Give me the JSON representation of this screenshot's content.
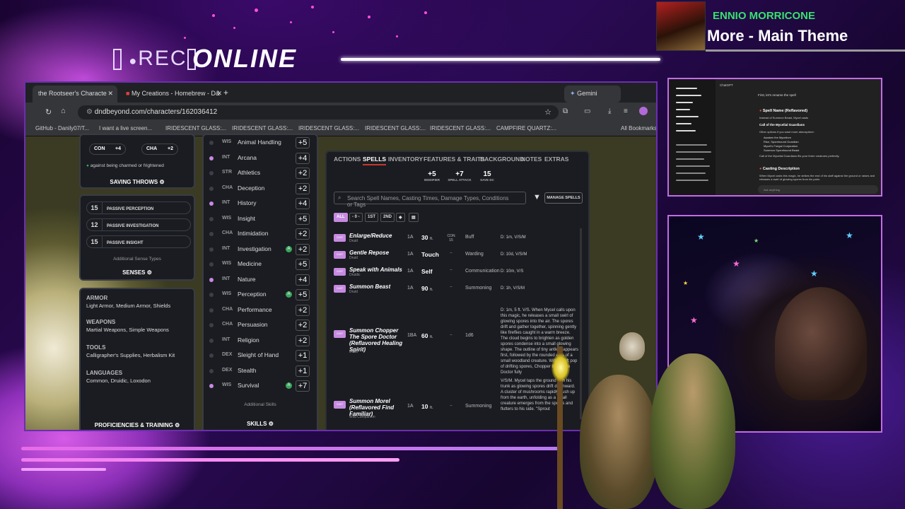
{
  "overlay": {
    "rec_label": "REC",
    "online_label": "ONLINE"
  },
  "now_playing": {
    "artist": "ENNIO MORRICONE",
    "title": "More - Main Theme",
    "artist_color": "#38e070"
  },
  "browser": {
    "tabs": [
      {
        "label": "the Rootseer's Characte",
        "active": true
      },
      {
        "label": "My Creations - Homebrew - D&",
        "active": false
      },
      {
        "label": "Gemini",
        "active": false
      }
    ],
    "url": "dndbeyond.com/characters/162036412",
    "bookmarks": [
      "GitHub - Danily07/T...",
      "I want a live screen...",
      "IRIDESCENT GLASS:...",
      "IRIDESCENT GLASS:...",
      "IRIDESCENT GLASS:...",
      "IRIDESCENT GLASS:...",
      "IRIDESCENT GLASS:...",
      "CAMPFIRE QUARTZ:...",
      "All Bookmarks"
    ]
  },
  "saving_throws": {
    "rows": [
      {
        "ability": "CON",
        "bonus": "+4"
      },
      {
        "ability": "CHA",
        "bonus": "+2"
      }
    ],
    "note": "against being charmed or frightened",
    "title": "SAVING THROWS"
  },
  "senses": {
    "items": [
      {
        "value": "15",
        "label": "PASSIVE PERCEPTION"
      },
      {
        "value": "12",
        "label": "PASSIVE INVESTIGATION"
      },
      {
        "value": "15",
        "label": "PASSIVE INSIGHT"
      }
    ],
    "additional": "Additional Sense Types",
    "title": "SENSES"
  },
  "proficiencies": {
    "groups": [
      {
        "heading": "ARMOR",
        "value": "Light Armor, Medium Armor, Shields"
      },
      {
        "heading": "WEAPONS",
        "value": "Martial Weapons, Simple Weapons"
      },
      {
        "heading": "TOOLS",
        "value": "Calligrapher's Supplies, Herbalism Kit"
      },
      {
        "heading": "LANGUAGES",
        "value": "Common, Druidic, Loxodon"
      }
    ],
    "title": "PROFICIENCIES & TRAINING"
  },
  "skills": {
    "items": [
      {
        "ab": "WIS",
        "name": "Animal Handling",
        "bonus": "+5",
        "prof": false,
        "adv": false
      },
      {
        "ab": "INT",
        "name": "Arcana",
        "bonus": "+4",
        "prof": true,
        "adv": false
      },
      {
        "ab": "STR",
        "name": "Athletics",
        "bonus": "+2",
        "prof": false,
        "adv": false
      },
      {
        "ab": "CHA",
        "name": "Deception",
        "bonus": "+2",
        "prof": false,
        "adv": false
      },
      {
        "ab": "INT",
        "name": "History",
        "bonus": "+4",
        "prof": true,
        "adv": false
      },
      {
        "ab": "WIS",
        "name": "Insight",
        "bonus": "+5",
        "prof": false,
        "adv": false
      },
      {
        "ab": "CHA",
        "name": "Intimidation",
        "bonus": "+2",
        "prof": false,
        "adv": false
      },
      {
        "ab": "INT",
        "name": "Investigation",
        "bonus": "+2",
        "prof": false,
        "adv": true
      },
      {
        "ab": "WIS",
        "name": "Medicine",
        "bonus": "+5",
        "prof": false,
        "adv": false
      },
      {
        "ab": "INT",
        "name": "Nature",
        "bonus": "+4",
        "prof": true,
        "adv": false
      },
      {
        "ab": "WIS",
        "name": "Perception",
        "bonus": "+5",
        "prof": false,
        "adv": true
      },
      {
        "ab": "CHA",
        "name": "Performance",
        "bonus": "+2",
        "prof": false,
        "adv": false
      },
      {
        "ab": "CHA",
        "name": "Persuasion",
        "bonus": "+2",
        "prof": false,
        "adv": false
      },
      {
        "ab": "INT",
        "name": "Religion",
        "bonus": "+2",
        "prof": false,
        "adv": false
      },
      {
        "ab": "DEX",
        "name": "Sleight of Hand",
        "bonus": "+1",
        "prof": false,
        "adv": false
      },
      {
        "ab": "DEX",
        "name": "Stealth",
        "bonus": "+1",
        "prof": false,
        "adv": false
      },
      {
        "ab": "WIS",
        "name": "Survival",
        "bonus": "+7",
        "prof": true,
        "adv": true
      }
    ],
    "additional": "Additional Skills",
    "title": "SKILLS"
  },
  "nav_tabs": [
    "ACTIONS",
    "SPELLS",
    "INVENTORY",
    "FEATURES & TRAITS",
    "BACKGROUND",
    "NOTES",
    "EXTRAS"
  ],
  "spell_stats": [
    {
      "value": "+5",
      "label": "MODIFIER"
    },
    {
      "value": "+7",
      "label": "SPELL ATTACK"
    },
    {
      "value": "15",
      "label": "SAVE DC"
    }
  ],
  "spell_search": {
    "placeholder": "Search Spell Names, Casting Times, Damage Types, Conditions or Tags",
    "manage": "MANAGE SPELLS"
  },
  "spell_filters": [
    "ALL",
    "- 0 -",
    "1ST",
    "2ND",
    "◆",
    "▤"
  ],
  "spells": [
    {
      "cast": "CAST",
      "name": "Enlarge/Reduce",
      "sub": "Druid",
      "time": "1A",
      "range": "30",
      "unit": "ft.",
      "hit": "CON 15",
      "effect": "Buff",
      "notes": "D: 1m, V/S/M"
    },
    {
      "cast": "CAST",
      "name": "Gentle Repose",
      "sub": "Druid",
      "time": "1A",
      "range": "Touch",
      "unit": "",
      "hit": "--",
      "effect": "Warding",
      "notes": "D: 10d, V/S/M"
    },
    {
      "cast": "CAST",
      "name": "Speak with Animals",
      "sub": "Druidic",
      "time": "1A",
      "range": "Self",
      "unit": "",
      "hit": "--",
      "effect": "Communication",
      "notes": "D: 10m, V/S"
    },
    {
      "cast": "CAST",
      "name": "Summon Beast",
      "sub": "Druid",
      "time": "1A",
      "range": "90",
      "unit": "ft.",
      "hit": "--",
      "effect": "Summoning",
      "notes": "D: 1h, V/S/M"
    },
    {
      "cast": "CAST",
      "name": "Summon Chopper The Spore Doctor (Reflavored Healing Spirit)",
      "sub": "Druid",
      "time": "1BA",
      "range": "60",
      "unit": "ft.",
      "hit": "--",
      "effect": "1d6",
      "notes": "D: 1m, 5 ft. V/S. When Mycel calls upon this magic, he releases a small swirl of glowing spores into the air. The spores drift and gather together, spinning gently like fireflies caught in a warm breeze. The cloud begins to brighten as golden spores condense into a small glowing shape. The outline of tiny antlers appears first, followed by the rounded ears of a small woodland creature. With a soft pop of drifting spores, Chopper the Spore Doctor fully"
    },
    {
      "cast": "CAST",
      "name": "Summon Morel (Reflavored Find Familiar)",
      "sub": "Wild Companion",
      "time": "1A",
      "range": "10",
      "unit": "ft.",
      "hit": "--",
      "effect": "Summoning",
      "notes": "V/S/M. Mycel taps the ground with his trunk as glowing spores drift downward. A cluster of mushrooms rapidly push up from the earth, unfolding as a small creature emerges from the spores and flutters to his side. \"Sprout"
    }
  ],
  "chatgpt": {
    "title": "ChatGPT",
    "intro": "First, let's rename the spell",
    "heading1": "Spell Name (Reflavored)",
    "line1": "Instead of Summon Beast, Mycel casts",
    "option": "Call of the Mycelial Guardians",
    "other": "Other options if you want more atmosphere:",
    "bullets": [
      "Awaken the Mycelium",
      "Rise, Sporebound Guardian",
      "Mycel's Fungal Conjuration",
      "Summon Sporebound Beast"
    ],
    "pick": "Call of the Mycelial Guardians fits your three creatures perfectly.",
    "heading2": "Casting Description",
    "body": "When Mycel casts this magic, he strikes the end of his staff against the ground or raises and releases a swirl of glowing spores from his palm.",
    "ask": "Ask anything"
  }
}
